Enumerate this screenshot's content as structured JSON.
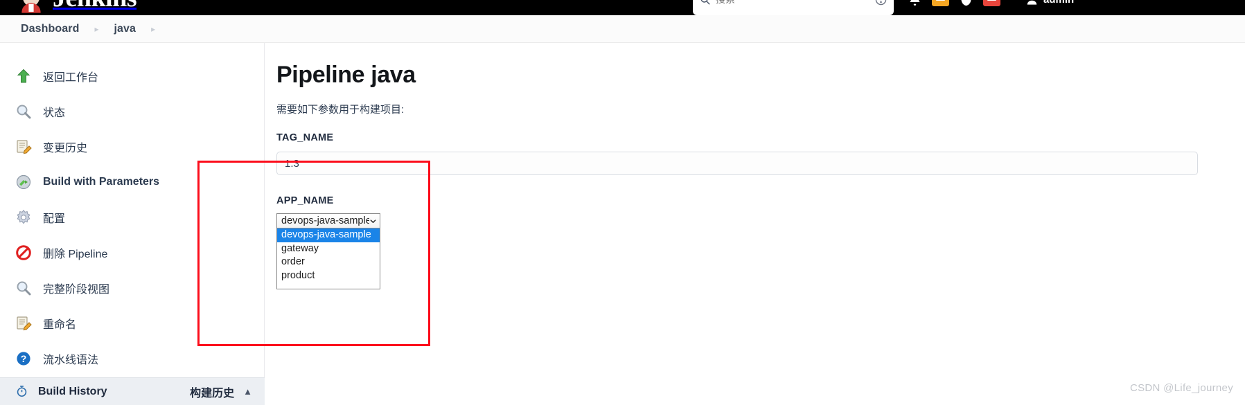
{
  "topbar": {
    "brand": "Jenkins",
    "brand_logo_icon": "jenkins-butler-logo",
    "search": {
      "value": "",
      "placeholder": "搜索"
    },
    "search_icon": "search-icon",
    "search_help_icon": "help-circle-icon",
    "bell_icon": "notification-bell-icon",
    "shield_icon": "security-shield-icon",
    "user_icon": "user-avatar-icon",
    "user_name": "admin"
  },
  "breadcrumb": {
    "items": [
      {
        "label": "Dashboard"
      },
      {
        "label": "java"
      }
    ],
    "separator": "▸"
  },
  "sidebar": {
    "items": [
      {
        "label": "返回工作台",
        "icon": "up-arrow-green-icon"
      },
      {
        "label": "状态",
        "icon": "magnifier-icon"
      },
      {
        "label": "变更历史",
        "icon": "notepad-pencil-icon"
      },
      {
        "label": "Build with Parameters",
        "icon": "build-play-icon",
        "lang": "en"
      },
      {
        "label": "配置",
        "icon": "gear-icon"
      },
      {
        "label": "删除 Pipeline",
        "icon": "no-entry-icon"
      },
      {
        "label": "完整阶段视图",
        "icon": "magnifier-icon"
      },
      {
        "label": "重命名",
        "icon": "notepad-pencil-icon"
      },
      {
        "label": "流水线语法",
        "icon": "question-help-icon"
      }
    ],
    "build_history": {
      "title": "Build History",
      "title_cn": "构建历史",
      "icon": "build-history-icon",
      "caret": "▲"
    }
  },
  "main": {
    "title": "Pipeline java",
    "description": "需要如下参数用于构建项目:",
    "parameters": [
      {
        "name": "TAG_NAME",
        "type": "text",
        "value": "1.3",
        "placeholder": ""
      },
      {
        "name": "APP_NAME",
        "type": "select",
        "value": "devops-java-sample",
        "open": true,
        "options": [
          {
            "label": "devops-java-sample",
            "selected": true
          },
          {
            "label": "gateway",
            "selected": false
          },
          {
            "label": "order",
            "selected": false
          },
          {
            "label": "product",
            "selected": false
          }
        ]
      }
    ]
  },
  "annotation": {
    "highlight_color": "#fc0d1b"
  },
  "watermark": "CSDN @Life_journey"
}
